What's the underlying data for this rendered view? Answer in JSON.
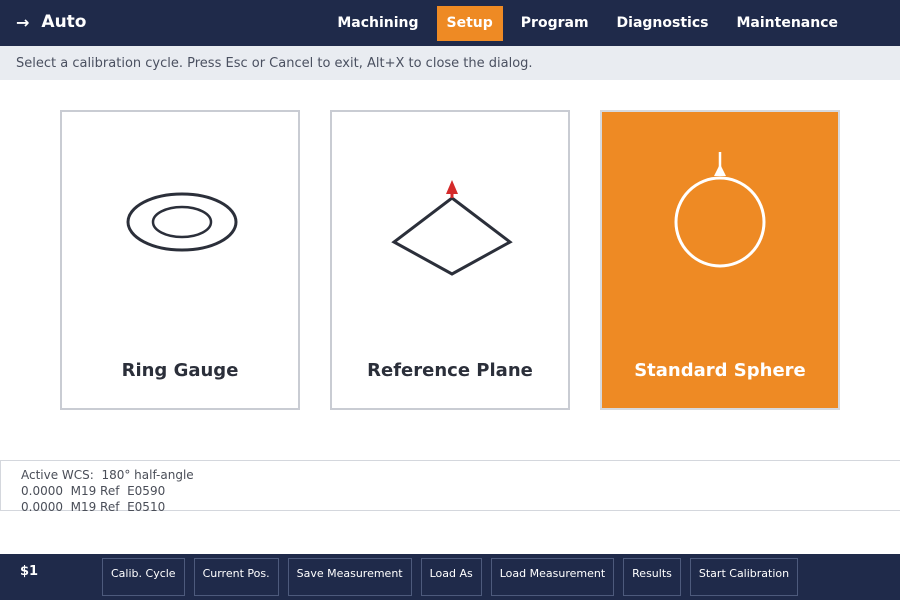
{
  "header": {
    "mode_label": "Auto",
    "tabs": [
      {
        "label": "Machining",
        "active": false
      },
      {
        "label": "Setup",
        "active": true
      },
      {
        "label": "Program",
        "active": false
      },
      {
        "label": "Diagnostics",
        "active": false
      },
      {
        "label": "Maintenance",
        "active": false
      }
    ]
  },
  "hint": "Select a calibration cycle. Press Esc or Cancel to exit, Alt+X to close the dialog.",
  "cards": [
    {
      "label": "Ring Gauge",
      "icon": "ring-gauge-icon",
      "selected": false
    },
    {
      "label": "Reference Plane",
      "icon": "reference-plane-icon",
      "selected": false
    },
    {
      "label": "Standard Sphere",
      "icon": "standard-sphere-icon",
      "selected": true
    }
  ],
  "info": {
    "line1": "Active WCS:  180° half-angle",
    "line2": "0.0000  M19 Ref  E0590",
    "line3": "0.0000  M19 Ref  E0510"
  },
  "footer": {
    "status": "$1",
    "softkeys": [
      "Calib. Cycle",
      "Current Pos.",
      "Save Measurement",
      "Load As",
      "Load Measurement",
      "Results",
      "Start Calibration"
    ]
  },
  "colors": {
    "navy": "#1f2a4a",
    "accent": "#ee8a24",
    "probe_tip": "#d42a2a"
  }
}
